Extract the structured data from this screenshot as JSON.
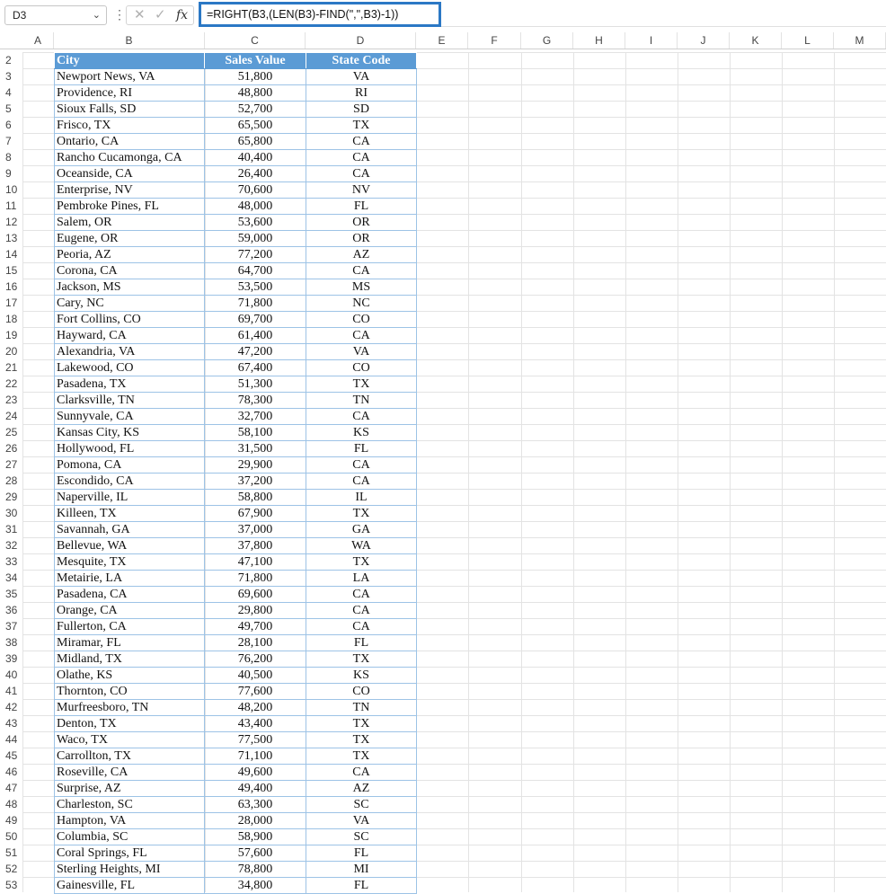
{
  "name_box": "D3",
  "formula": "=RIGHT(B3,(LEN(B3)-FIND(\",\",B3)-1))",
  "formula_icons": {
    "cancel": "✕",
    "confirm": "✓",
    "fx": "fx"
  },
  "columns": [
    "A",
    "B",
    "C",
    "D",
    "E",
    "F",
    "G",
    "H",
    "I",
    "J",
    "K",
    "L",
    "M"
  ],
  "headers": {
    "city": "City",
    "sales": "Sales Value",
    "code": "State Code"
  },
  "rows": [
    {
      "r": "3",
      "city": "Newport News, VA",
      "sales": "51,800",
      "code": "VA"
    },
    {
      "r": "4",
      "city": "Providence, RI",
      "sales": "48,800",
      "code": "RI"
    },
    {
      "r": "5",
      "city": "Sioux Falls, SD",
      "sales": "52,700",
      "code": "SD"
    },
    {
      "r": "6",
      "city": "Frisco, TX",
      "sales": "65,500",
      "code": "TX"
    },
    {
      "r": "7",
      "city": "Ontario, CA",
      "sales": "65,800",
      "code": "CA"
    },
    {
      "r": "8",
      "city": "Rancho Cucamonga, CA",
      "sales": "40,400",
      "code": "CA"
    },
    {
      "r": "9",
      "city": "Oceanside, CA",
      "sales": "26,400",
      "code": "CA"
    },
    {
      "r": "10",
      "city": "Enterprise, NV",
      "sales": "70,600",
      "code": "NV"
    },
    {
      "r": "11",
      "city": "Pembroke Pines, FL",
      "sales": "48,000",
      "code": "FL"
    },
    {
      "r": "12",
      "city": "Salem, OR",
      "sales": "53,600",
      "code": "OR"
    },
    {
      "r": "13",
      "city": "Eugene, OR",
      "sales": "59,000",
      "code": "OR"
    },
    {
      "r": "14",
      "city": "Peoria, AZ",
      "sales": "77,200",
      "code": "AZ"
    },
    {
      "r": "15",
      "city": "Corona, CA",
      "sales": "64,700",
      "code": "CA"
    },
    {
      "r": "16",
      "city": "Jackson, MS",
      "sales": "53,500",
      "code": "MS"
    },
    {
      "r": "17",
      "city": "Cary, NC",
      "sales": "71,800",
      "code": "NC"
    },
    {
      "r": "18",
      "city": "Fort Collins, CO",
      "sales": "69,700",
      "code": "CO"
    },
    {
      "r": "19",
      "city": "Hayward, CA",
      "sales": "61,400",
      "code": "CA"
    },
    {
      "r": "20",
      "city": "Alexandria, VA",
      "sales": "47,200",
      "code": "VA"
    },
    {
      "r": "21",
      "city": "Lakewood, CO",
      "sales": "67,400",
      "code": "CO"
    },
    {
      "r": "22",
      "city": "Pasadena, TX",
      "sales": "51,300",
      "code": "TX"
    },
    {
      "r": "23",
      "city": "Clarksville, TN",
      "sales": "78,300",
      "code": "TN"
    },
    {
      "r": "24",
      "city": "Sunnyvale, CA",
      "sales": "32,700",
      "code": "CA"
    },
    {
      "r": "25",
      "city": "Kansas City, KS",
      "sales": "58,100",
      "code": "KS"
    },
    {
      "r": "26",
      "city": "Hollywood, FL",
      "sales": "31,500",
      "code": "FL"
    },
    {
      "r": "27",
      "city": "Pomona, CA",
      "sales": "29,900",
      "code": "CA"
    },
    {
      "r": "28",
      "city": "Escondido, CA",
      "sales": "37,200",
      "code": "CA"
    },
    {
      "r": "29",
      "city": "Naperville, IL",
      "sales": "58,800",
      "code": "IL"
    },
    {
      "r": "30",
      "city": "Killeen, TX",
      "sales": "67,900",
      "code": "TX"
    },
    {
      "r": "31",
      "city": "Savannah, GA",
      "sales": "37,000",
      "code": "GA"
    },
    {
      "r": "32",
      "city": "Bellevue, WA",
      "sales": "37,800",
      "code": "WA"
    },
    {
      "r": "33",
      "city": "Mesquite, TX",
      "sales": "47,100",
      "code": "TX"
    },
    {
      "r": "34",
      "city": "Metairie, LA",
      "sales": "71,800",
      "code": "LA"
    },
    {
      "r": "35",
      "city": "Pasadena, CA",
      "sales": "69,600",
      "code": "CA"
    },
    {
      "r": "36",
      "city": "Orange, CA",
      "sales": "29,800",
      "code": "CA"
    },
    {
      "r": "37",
      "city": "Fullerton, CA",
      "sales": "49,700",
      "code": "CA"
    },
    {
      "r": "38",
      "city": "Miramar, FL",
      "sales": "28,100",
      "code": "FL"
    },
    {
      "r": "39",
      "city": "Midland, TX",
      "sales": "76,200",
      "code": "TX"
    },
    {
      "r": "40",
      "city": "Olathe, KS",
      "sales": "40,500",
      "code": "KS"
    },
    {
      "r": "41",
      "city": "Thornton, CO",
      "sales": "77,600",
      "code": "CO"
    },
    {
      "r": "42",
      "city": "Murfreesboro, TN",
      "sales": "48,200",
      "code": "TN"
    },
    {
      "r": "43",
      "city": "Denton, TX",
      "sales": "43,400",
      "code": "TX"
    },
    {
      "r": "44",
      "city": "Waco, TX",
      "sales": "77,500",
      "code": "TX"
    },
    {
      "r": "45",
      "city": "Carrollton, TX",
      "sales": "71,100",
      "code": "TX"
    },
    {
      "r": "46",
      "city": "Roseville, CA",
      "sales": "49,600",
      "code": "CA"
    },
    {
      "r": "47",
      "city": "Surprise, AZ",
      "sales": "49,400",
      "code": "AZ"
    },
    {
      "r": "48",
      "city": "Charleston, SC",
      "sales": "63,300",
      "code": "SC"
    },
    {
      "r": "49",
      "city": "Hampton, VA",
      "sales": "28,000",
      "code": "VA"
    },
    {
      "r": "50",
      "city": "Columbia, SC",
      "sales": "58,900",
      "code": "SC"
    },
    {
      "r": "51",
      "city": "Coral Springs, FL",
      "sales": "57,600",
      "code": "FL"
    },
    {
      "r": "52",
      "city": "Sterling Heights, MI",
      "sales": "78,800",
      "code": "MI"
    },
    {
      "r": "53",
      "city": "Gainesville, FL",
      "sales": "34,800",
      "code": "FL"
    }
  ]
}
